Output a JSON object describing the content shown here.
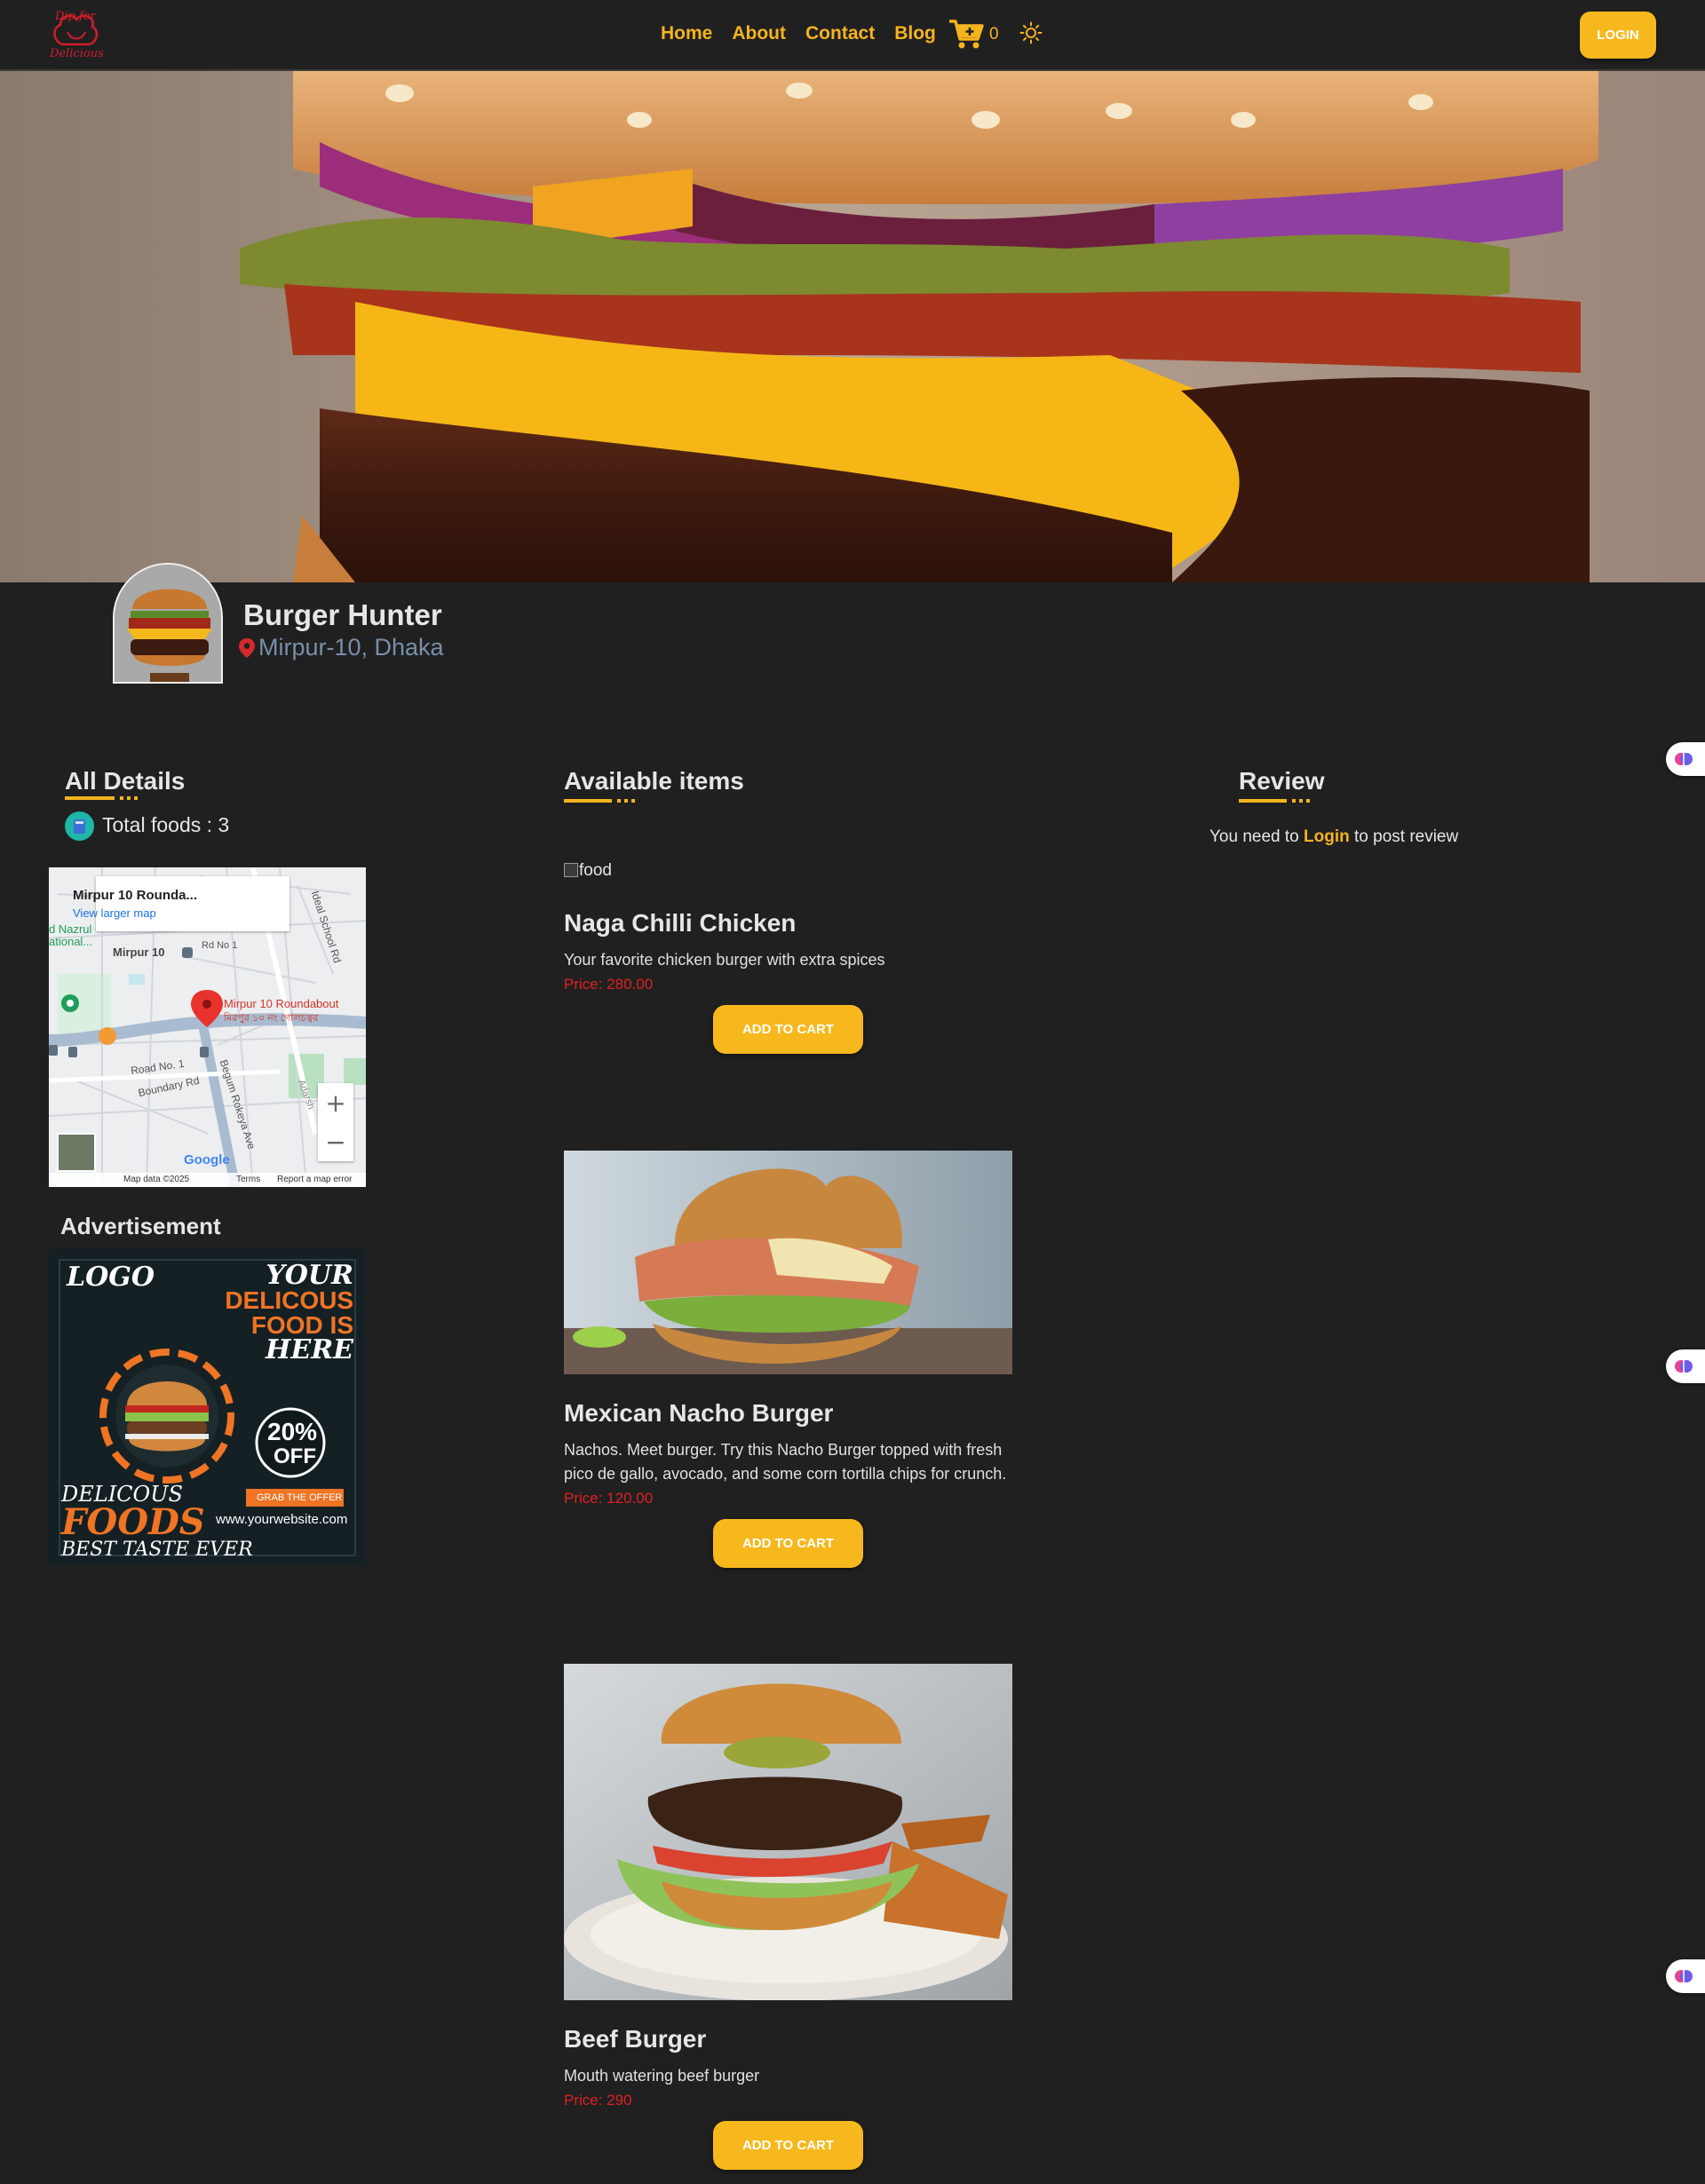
{
  "nav": {
    "logo_line1": "Dip for",
    "logo_line2": "Delicious",
    "links": [
      "Home",
      "About",
      "Contact",
      "Blog"
    ],
    "cart_icon": "cart-icon",
    "cart_count": "0",
    "theme_icon": "sun-icon",
    "login_label": "LOGIN"
  },
  "shop": {
    "name": "Burger Hunter",
    "location_icon": "map-pin-icon",
    "location": "Mirpur-10, Dhaka"
  },
  "details": {
    "title": "All Details",
    "total_foods_label": "Total foods : 3",
    "map": {
      "card_title": "Mirpur 10 Rounda...",
      "card_link": "View larger map",
      "place_label": "Mirpur 10 Roundabout",
      "place_label_bn": "মিরপুর ১০ নং গোলচত্বর",
      "area_label": "Mirpur 10",
      "road_no1": "Road No. 1",
      "rd_no1": "Rd No 1",
      "boundary_rd": "Boundary Rd",
      "begum_rokeya": "Begum Rokeya Ave",
      "ideal_school": "Ideal School Rd",
      "nazrul": "d Nazrul",
      "national": "ational...",
      "adarsh": "Adarsh",
      "google": "Google",
      "footer": {
        "data": "Map data ©2025",
        "terms": "Terms",
        "report": "Report a map error"
      },
      "zoom_in": "+",
      "zoom_out": "−"
    }
  },
  "advertisement": {
    "title": "Advertisement",
    "logo": "LOGO",
    "headline_1": "YOUR",
    "headline_2": "DELICOUS",
    "headline_3": "FOOD IS",
    "headline_4": "HERE",
    "discount_1": "20%",
    "discount_2": "OFF",
    "cta": "GRAB THE OFFER",
    "website": "www.yourwebsite.com",
    "tagline_1": "DELICOUS",
    "tagline_2": "FOODS",
    "tagline_3": "BEST TASTE EVER"
  },
  "items": {
    "title": "Available items",
    "broken_alt": "food",
    "list": [
      {
        "name": "Naga Chilli Chicken",
        "description": "Your favorite chicken burger with extra spices",
        "price": "Price: 280.00",
        "button": "ADD TO CART"
      },
      {
        "name": "Mexican Nacho Burger",
        "description": "Nachos. Meet burger. Try this Nacho Burger topped with fresh pico de gallo, avocado, and some corn tortilla chips for crunch.",
        "price": "Price: 120.00",
        "button": "ADD TO CART"
      },
      {
        "name": "Beef Burger",
        "description": "Mouth watering beef burger",
        "price": "Price: 290",
        "button": "ADD TO CART"
      }
    ]
  },
  "review": {
    "title": "Review",
    "note_prefix": "You need to ",
    "note_link": "Login",
    "note_suffix": " to post review"
  },
  "colors": {
    "background": "#202021",
    "accent": "#f5b41e",
    "price": "#e02020",
    "brand_red": "#d11d2a"
  }
}
